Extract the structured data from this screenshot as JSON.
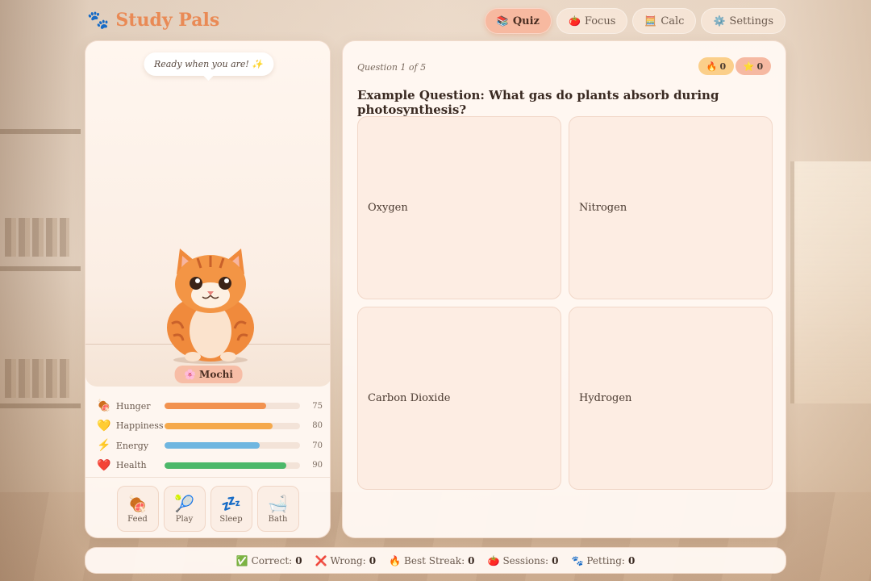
{
  "brand": {
    "icon": "🐾",
    "title": "Study Pals"
  },
  "nav": [
    {
      "icon": "📚",
      "label": "Quiz",
      "active": true
    },
    {
      "icon": "🍅",
      "label": "Focus",
      "active": false
    },
    {
      "icon": "🧮",
      "label": "Calc",
      "active": false
    },
    {
      "icon": "⚙️",
      "label": "Settings",
      "active": false
    }
  ],
  "pet": {
    "bubble": "Ready when you are! ✨",
    "name_icon": "🌸",
    "name": "Mochi",
    "stats": [
      {
        "icon": "🍖",
        "label": "Hunger",
        "value": 75,
        "color": "#f2924f"
      },
      {
        "icon": "💛",
        "label": "Happiness",
        "value": 80,
        "color": "#f5a94c"
      },
      {
        "icon": "⚡",
        "label": "Energy",
        "value": 70,
        "color": "#6fb6e0"
      },
      {
        "icon": "❤️",
        "label": "Health",
        "value": 90,
        "color": "#4cb86a"
      }
    ],
    "actions": [
      {
        "icon": "🍖",
        "label": "Feed"
      },
      {
        "icon": "🎾",
        "label": "Play"
      },
      {
        "icon": "💤",
        "label": "Sleep"
      },
      {
        "icon": "🛁",
        "label": "Bath"
      }
    ]
  },
  "quiz": {
    "counter": "Question 1 of 5",
    "streak": {
      "icon": "🔥",
      "value": "0"
    },
    "stars": {
      "icon": "⭐",
      "value": "0"
    },
    "question": "Example Question: What gas do plants absorb during photosynthesis?",
    "answers": [
      "Oxygen",
      "Nitrogen",
      "Carbon Dioxide",
      "Hydrogen"
    ]
  },
  "footer": [
    {
      "icon": "✅",
      "label": "Correct:",
      "value": "0"
    },
    {
      "icon": "❌",
      "label": "Wrong:",
      "value": "0"
    },
    {
      "icon": "🔥",
      "label": "Best Streak:",
      "value": "0"
    },
    {
      "icon": "🍅",
      "label": "Sessions:",
      "value": "0"
    },
    {
      "icon": "🐾",
      "label": "Petting:",
      "value": "0"
    }
  ]
}
